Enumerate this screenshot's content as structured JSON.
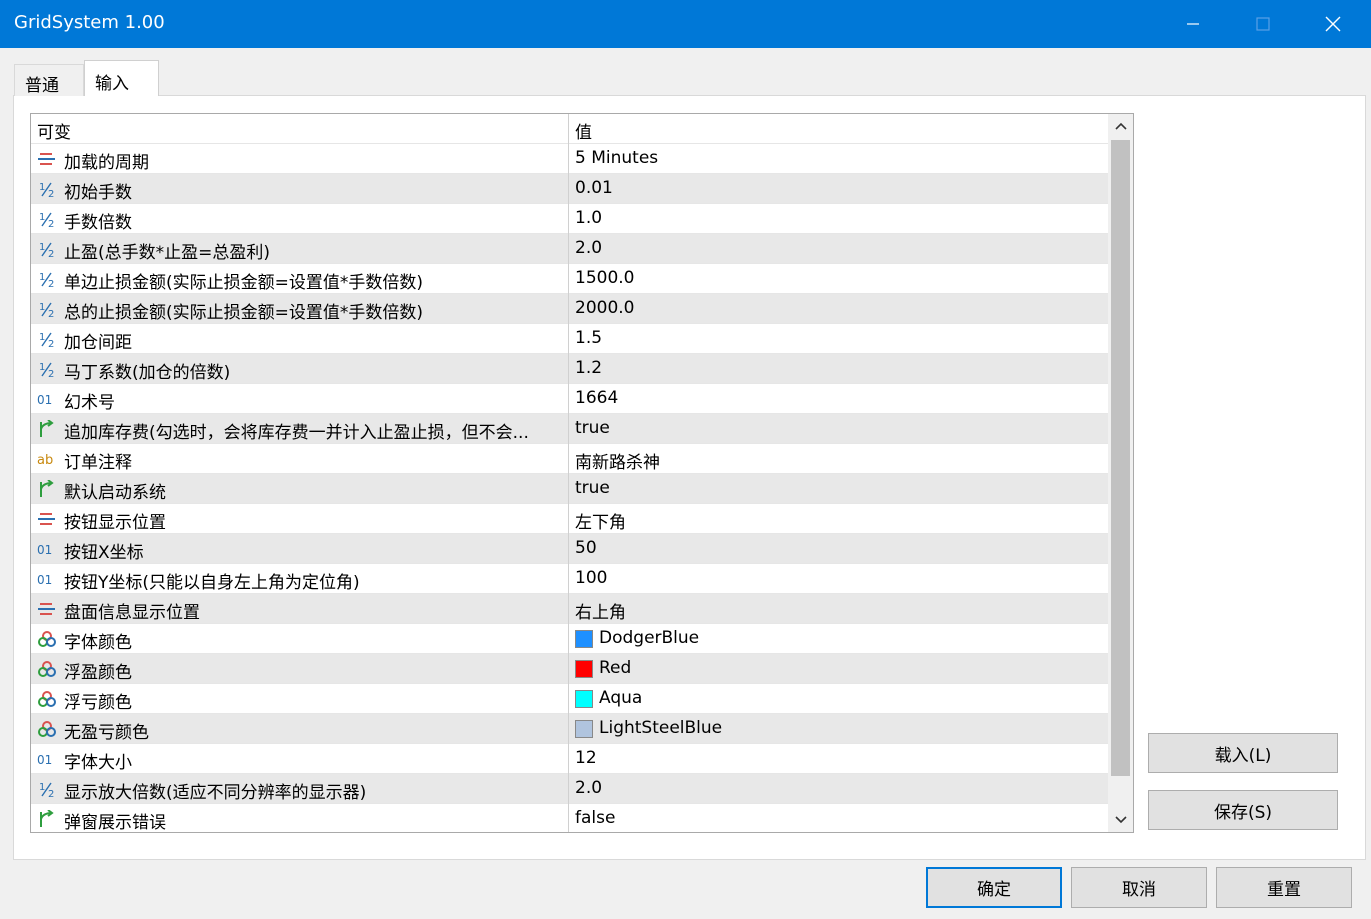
{
  "window": {
    "title": "GridSystem 1.00"
  },
  "tabs": [
    {
      "label": "普通"
    },
    {
      "label": "输入"
    }
  ],
  "grid": {
    "headers": {
      "name": "可变",
      "value": "值"
    },
    "rows": [
      {
        "icon": "enum-icon",
        "name": "加载的周期",
        "value": "5 Minutes"
      },
      {
        "icon": "double-icon",
        "name": "初始手数",
        "value": "0.01"
      },
      {
        "icon": "double-icon",
        "name": "手数倍数",
        "value": "1.0"
      },
      {
        "icon": "double-icon",
        "name": "止盈(总手数*止盈=总盈利)",
        "value": "2.0"
      },
      {
        "icon": "double-icon",
        "name": "单边止损金额(实际止损金额=设置值*手数倍数)",
        "value": "1500.0"
      },
      {
        "icon": "double-icon",
        "name": "总的止损金额(实际止损金额=设置值*手数倍数)",
        "value": "2000.0"
      },
      {
        "icon": "double-icon",
        "name": "加仓间距",
        "value": "1.5"
      },
      {
        "icon": "double-icon",
        "name": "马丁系数(加仓的倍数)",
        "value": "1.2"
      },
      {
        "icon": "integer-icon",
        "name": "幻术号",
        "value": "1664"
      },
      {
        "icon": "bool-icon",
        "name": "追加库存费(勾选时，会将库存费一并计入止盈止损，但不会...",
        "value": "true"
      },
      {
        "icon": "string-icon",
        "name": "订单注释",
        "value": "南新路杀神"
      },
      {
        "icon": "bool-icon",
        "name": "默认启动系统",
        "value": "true"
      },
      {
        "icon": "enum-icon",
        "name": "按钮显示位置",
        "value": "左下角"
      },
      {
        "icon": "integer-icon",
        "name": "按钮X坐标",
        "value": "50"
      },
      {
        "icon": "integer-icon",
        "name": "按钮Y坐标(只能以自身左上角为定位角)",
        "value": "100"
      },
      {
        "icon": "enum-icon",
        "name": "盘面信息显示位置",
        "value": "右上角"
      },
      {
        "icon": "color-icon",
        "name": "字体颜色",
        "value": "DodgerBlue",
        "swatch": "#1e90ff"
      },
      {
        "icon": "color-icon",
        "name": "浮盈颜色",
        "value": "Red",
        "swatch": "#ff0000"
      },
      {
        "icon": "color-icon",
        "name": "浮亏颜色",
        "value": "Aqua",
        "swatch": "#00ffff"
      },
      {
        "icon": "color-icon",
        "name": "无盈亏颜色",
        "value": "LightSteelBlue",
        "swatch": "#b0c4de"
      },
      {
        "icon": "integer-icon",
        "name": "字体大小",
        "value": "12"
      },
      {
        "icon": "double-icon",
        "name": "显示放大倍数(适应不同分辨率的显示器)",
        "value": "2.0"
      },
      {
        "icon": "bool-icon",
        "name": "弹窗展示错误",
        "value": "false"
      }
    ]
  },
  "side_buttons": {
    "load": "载入(L)",
    "save": "保存(S)"
  },
  "footer": {
    "ok": "确定",
    "cancel": "取消",
    "reset": "重置"
  }
}
